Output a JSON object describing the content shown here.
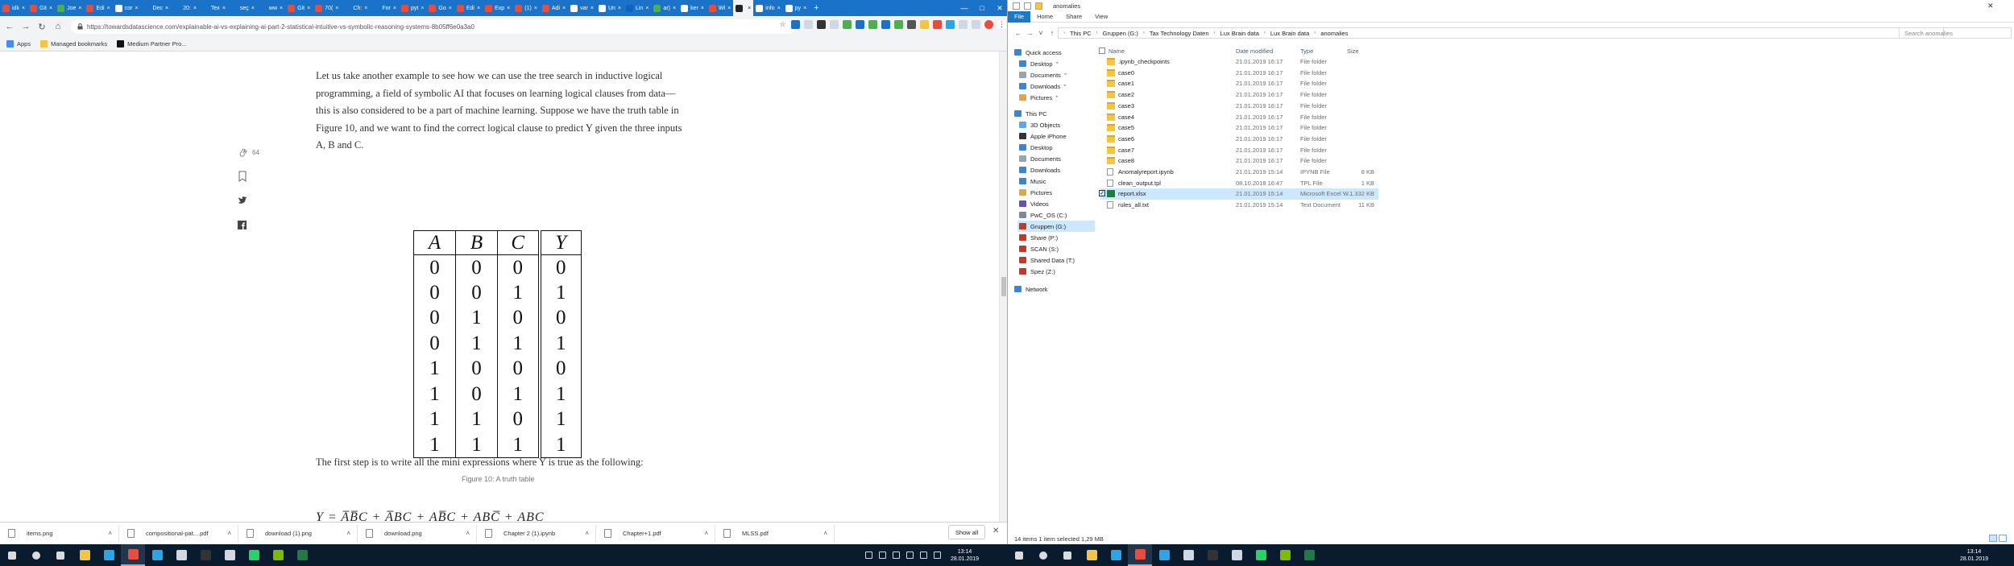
{
  "browser": {
    "tabs": [
      {
        "label": "idk",
        "color": "#e84c3d"
      },
      {
        "label": "Git",
        "color": "#e84c3d"
      },
      {
        "label": "Joe",
        "color": "#4caf50"
      },
      {
        "label": "Edi",
        "color": "#e84c3d"
      },
      {
        "label": "cor",
        "color": "#ffffff"
      },
      {
        "label": "Dec",
        "color": "#1a73c8"
      },
      {
        "label": "20:",
        "color": "#1a73c8"
      },
      {
        "label": "Tex",
        "color": "#1a73c8"
      },
      {
        "label": "seç",
        "color": "#1a73c8"
      },
      {
        "label": "ww",
        "color": "#1a73c8"
      },
      {
        "label": "Git",
        "color": "#e84c3d"
      },
      {
        "label": "70(",
        "color": "#e84c3d"
      },
      {
        "label": "Ch:",
        "color": "#1a73c8"
      },
      {
        "label": "For",
        "color": "#1a73c8"
      },
      {
        "label": "pyt",
        "color": "#e84c3d"
      },
      {
        "label": "Go",
        "color": "#e84c3d"
      },
      {
        "label": "Edi",
        "color": "#e84c3d"
      },
      {
        "label": "Exp",
        "color": "#e84c3d"
      },
      {
        "label": "(1)",
        "color": "#e84c3d"
      },
      {
        "label": "Adi",
        "color": "#e84c3d"
      },
      {
        "label": "var",
        "color": "#ffffff"
      },
      {
        "label": "Un",
        "color": "#ffffff"
      },
      {
        "label": "Lin",
        "color": "#0a66c2"
      },
      {
        "label": "ar)",
        "color": "#4caf50"
      },
      {
        "label": "ker",
        "color": "#ffffff"
      },
      {
        "label": "Wł",
        "color": "#e84c3d"
      },
      {
        "label": "",
        "color": "#222222",
        "active": true
      },
      {
        "label": "info",
        "color": "#ffffff"
      },
      {
        "label": "py",
        "color": "#ffffff"
      }
    ],
    "new_tab": "+",
    "url": "https://towardsdatascience.com/explainable-ai-vs-explaining-ai-part-2-statistical-intuitive-vs-symbolic-reasoning-systems-8b05ff6e0a3a0",
    "bookmarks": [
      {
        "label": "Apps",
        "color": "#4a8af4"
      },
      {
        "label": "Managed bookmarks",
        "color": "#f4c542"
      },
      {
        "label": "Medium Partner Pro...",
        "color": "#111111"
      }
    ],
    "article": {
      "para1": "Let us take another example to see how we can use the tree search in inductive logical programming, a field of symbolic AI that focuses on learning logical clauses from data—this is also considered to be a part of machine learning. Suppose we have the truth table in Figure 10, and we want to find the correct logical clause to predict Y given the three inputs A, B and C.",
      "para2": "The first step is to write all the mini expressions where Y is true as the following:",
      "clap_count": "64",
      "caption": "Figure 10: A truth table",
      "formula": "Y = A̅B̅C + A̅BC + AB̅C + ABC̅ + ABC"
    },
    "truth_table": {
      "headers": [
        "A",
        "B",
        "C",
        "Y"
      ],
      "rows": [
        [
          "0",
          "0",
          "0",
          "0"
        ],
        [
          "0",
          "0",
          "1",
          "1"
        ],
        [
          "0",
          "1",
          "0",
          "0"
        ],
        [
          "0",
          "1",
          "1",
          "1"
        ],
        [
          "1",
          "0",
          "0",
          "0"
        ],
        [
          "1",
          "0",
          "1",
          "1"
        ],
        [
          "1",
          "1",
          "0",
          "1"
        ],
        [
          "1",
          "1",
          "1",
          "1"
        ]
      ]
    },
    "downloads": [
      {
        "name": "items.png"
      },
      {
        "name": "compositional-pat....pdf"
      },
      {
        "name": "download (1).png"
      },
      {
        "name": "download.png"
      },
      {
        "name": "Chapter 2 (1).ipynb"
      },
      {
        "name": "Chapter+1.pdf"
      },
      {
        "name": "MLSS.pdf"
      }
    ],
    "show_all": "Show all"
  },
  "explorer": {
    "title": "anomalies",
    "ribbon_tabs": [
      "File",
      "Home",
      "Share",
      "View"
    ],
    "breadcrumbs": [
      "This PC",
      "Gruppen (G:)",
      "Tax Technology Daten",
      "Lux Brain data",
      "Lux Brain data",
      "anomalies"
    ],
    "search_placeholder": "Search anomalies",
    "columns": [
      "Name",
      "Date modified",
      "Type",
      "Size"
    ],
    "nav": [
      {
        "label": "Quick access",
        "color": "#3a86d6",
        "pin": false
      },
      {
        "label": "Desktop",
        "color": "#3a86d6",
        "pin": true
      },
      {
        "label": "Documents",
        "color": "#9aa4b0",
        "pin": true
      },
      {
        "label": "Downloads",
        "color": "#3a86d6",
        "pin": true
      },
      {
        "label": "Pictures",
        "color": "#dca84a",
        "pin": true
      },
      {
        "label": "This PC",
        "color": "#3a86d6",
        "pin": false
      },
      {
        "label": "3D Objects",
        "color": "#5aa9e6",
        "pin": false
      },
      {
        "label": "Apple iPhone",
        "color": "#333333",
        "pin": false
      },
      {
        "label": "Desktop",
        "color": "#3a86d6",
        "pin": false
      },
      {
        "label": "Documents",
        "color": "#9aa4b0",
        "pin": false
      },
      {
        "label": "Downloads",
        "color": "#3a86d6",
        "pin": false
      },
      {
        "label": "Music",
        "color": "#3a86d6",
        "pin": false
      },
      {
        "label": "Pictures",
        "color": "#dca84a",
        "pin": false
      },
      {
        "label": "Videos",
        "color": "#6b4bb5",
        "pin": false
      },
      {
        "label": "PwC_OS (C:)",
        "color": "#7a8a9a",
        "pin": false
      },
      {
        "label": "Gruppen (G:)",
        "color": "#c0392b",
        "pin": false,
        "selected": true
      },
      {
        "label": "Share (P:)",
        "color": "#c0392b",
        "pin": false
      },
      {
        "label": "SCAN (S:)",
        "color": "#c0392b",
        "pin": false
      },
      {
        "label": "Shared Data (T:)",
        "color": "#c0392b",
        "pin": false
      },
      {
        "label": "Spez (Z:)",
        "color": "#c0392b",
        "pin": false
      },
      {
        "label": "Network",
        "color": "#3a86d6",
        "pin": false
      }
    ],
    "files": [
      {
        "name": ".ipynb_checkpoints",
        "date": "21.01.2019 16:17",
        "type": "File folder",
        "size": "",
        "icon": "folder"
      },
      {
        "name": "case0",
        "date": "21.01.2019 16:17",
        "type": "File folder",
        "size": "",
        "icon": "folder"
      },
      {
        "name": "case1",
        "date": "21.01.2019 16:17",
        "type": "File folder",
        "size": "",
        "icon": "folder"
      },
      {
        "name": "case2",
        "date": "21.01.2019 16:17",
        "type": "File folder",
        "size": "",
        "icon": "folder"
      },
      {
        "name": "case3",
        "date": "21.01.2019 16:17",
        "type": "File folder",
        "size": "",
        "icon": "folder"
      },
      {
        "name": "case4",
        "date": "21.01.2019 16:17",
        "type": "File folder",
        "size": "",
        "icon": "folder"
      },
      {
        "name": "case5",
        "date": "21.01.2019 16:17",
        "type": "File folder",
        "size": "",
        "icon": "folder"
      },
      {
        "name": "case6",
        "date": "21.01.2019 16:17",
        "type": "File folder",
        "size": "",
        "icon": "folder"
      },
      {
        "name": "case7",
        "date": "21.01.2019 16:17",
        "type": "File folder",
        "size": "",
        "icon": "folder"
      },
      {
        "name": "case8",
        "date": "21.01.2019 16:17",
        "type": "File folder",
        "size": "",
        "icon": "folder"
      },
      {
        "name": "Anomalyreport.ipynb",
        "date": "21.01.2019 15:14",
        "type": "IPYNB File",
        "size": "8 KB",
        "icon": "file"
      },
      {
        "name": "clean_output.tpl",
        "date": "08.10.2018 16:47",
        "type": "TPL File",
        "size": "1 KB",
        "icon": "file"
      },
      {
        "name": "report.xlsx",
        "date": "21.01.2019 15:14",
        "type": "Microsoft Excel W...",
        "size": "1.332 KB",
        "icon": "excel",
        "selected": true
      },
      {
        "name": "rules_all.txt",
        "date": "21.01.2019 15:14",
        "type": "Text Document",
        "size": "11 KB",
        "icon": "file"
      }
    ],
    "status": "14 items     1 item selected  1,29 MB"
  },
  "taskbar": {
    "left_icons": [
      {
        "name": "start-icon",
        "color": "#ffffff"
      },
      {
        "name": "search-icon",
        "color": "#ffffff"
      },
      {
        "name": "task-view-icon",
        "color": "#ffffff"
      },
      {
        "name": "file-explorer-icon",
        "color": "#f4c542"
      },
      {
        "name": "ie-icon",
        "color": "#2aa5e6"
      },
      {
        "name": "chrome-icon",
        "color": "#e84c3d",
        "active": true
      },
      {
        "name": "edge-icon",
        "color": "#2aa5e6"
      },
      {
        "name": "browser-icon",
        "color": "#cfd8e3"
      },
      {
        "name": "terminal-icon",
        "color": "#333333"
      },
      {
        "name": "app-icon",
        "color": "#cfd8e3"
      },
      {
        "name": "whatsapp-icon",
        "color": "#25d366"
      },
      {
        "name": "app2-icon",
        "color": "#7fba00"
      },
      {
        "name": "excel-icon",
        "color": "#1f7a44"
      }
    ],
    "time": "13:14",
    "date": "28.01.2019"
  }
}
